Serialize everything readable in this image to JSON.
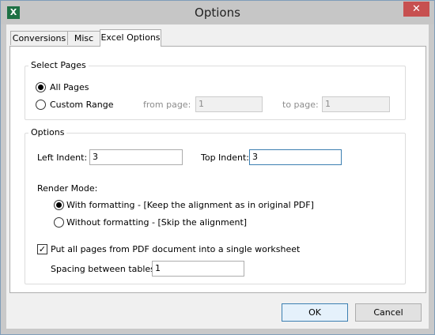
{
  "window": {
    "title": "Options",
    "app_icon": "excel-icon",
    "close_glyph": "✕"
  },
  "tabs": [
    {
      "label": "Conversions",
      "active": false
    },
    {
      "label": "Misc",
      "active": false
    },
    {
      "label": "Excel Options",
      "active": true
    }
  ],
  "select_pages": {
    "legend": "Select Pages",
    "all_pages": {
      "label": "All Pages",
      "checked": true
    },
    "custom_range": {
      "label": "Custom Range",
      "checked": false
    },
    "from_page": {
      "label": "from page:",
      "value": "1"
    },
    "to_page": {
      "label": "to page:",
      "value": "1"
    }
  },
  "options": {
    "legend": "Options",
    "left_indent": {
      "label": "Left Indent:",
      "value": "3"
    },
    "top_indent": {
      "label": "Top Indent:",
      "value": "3"
    },
    "render_mode": {
      "label": "Render Mode:",
      "with_formatting": {
        "label": "With formatting - [Keep the alignment as in original PDF]",
        "checked": true
      },
      "without_formatting": {
        "label": "Without formatting - [Skip the alignment]",
        "checked": false
      }
    },
    "single_worksheet": {
      "label": "Put all pages from PDF document into a single worksheet",
      "checked": true
    },
    "spacing": {
      "label": "Spacing between tables:",
      "value": "1"
    }
  },
  "buttons": {
    "ok": "OK",
    "cancel": "Cancel"
  }
}
